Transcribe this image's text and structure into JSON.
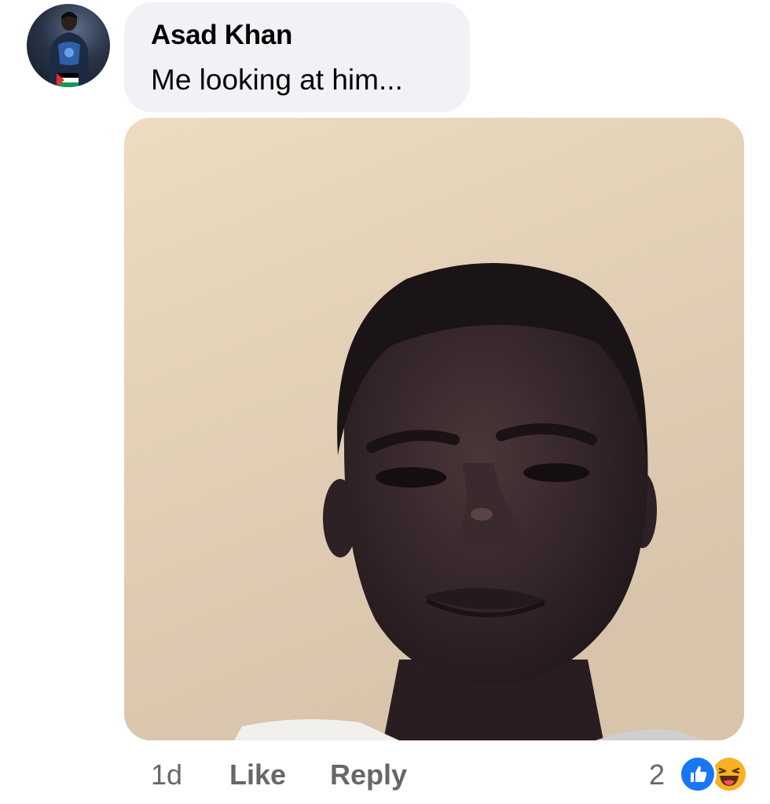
{
  "comment": {
    "author": "Asad Khan",
    "text": "Me looking at him...",
    "avatar_icon": "profile-avatar",
    "attachment_icon": "meme-photo"
  },
  "actions": {
    "time": "1d",
    "like_label": "Like",
    "reply_label": "Reply"
  },
  "reactions": {
    "count": "2",
    "types": [
      "like-reaction-icon",
      "haha-reaction-icon"
    ],
    "colors": {
      "like": "#1877f2",
      "haha": "#f7b125"
    }
  },
  "colors": {
    "bubble": "#f0f2f5",
    "secondary_text": "#65676b",
    "primary_text": "#050505"
  }
}
